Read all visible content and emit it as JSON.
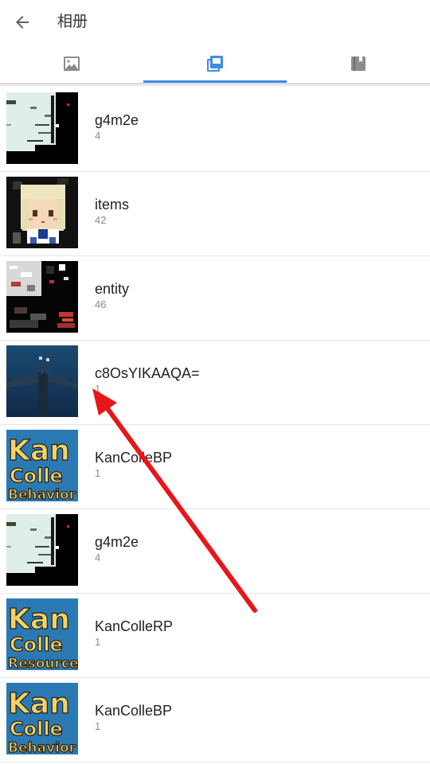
{
  "appbar": {
    "title": "相册",
    "back_icon": "arrow-back-icon"
  },
  "tabs": [
    {
      "icon": "image-icon",
      "selected": false
    },
    {
      "icon": "album-icon",
      "selected": true
    },
    {
      "icon": "collection-icon",
      "selected": false
    }
  ],
  "colors": {
    "accent": "#3f8de8",
    "annotation_arrow": "#e8151b"
  },
  "albums": [
    {
      "name": "g4m2e",
      "count": "4",
      "thumb": "game-screenshot"
    },
    {
      "name": "items",
      "count": "42",
      "thumb": "anime-character"
    },
    {
      "name": "entity",
      "count": "46",
      "thumb": "sprite-sheet"
    },
    {
      "name": "c8OsYIKAAQA=",
      "count": "1",
      "thumb": "dark-blue-image"
    },
    {
      "name": "KanColleBP",
      "count": "1",
      "thumb": "kancolle-behavior-logo",
      "logo_lines": [
        "Kan",
        "Colle",
        "Behavior"
      ]
    },
    {
      "name": "g4m2e",
      "count": "4",
      "thumb": "game-screenshot"
    },
    {
      "name": "KanColleRP",
      "count": "1",
      "thumb": "kancolle-resource-logo",
      "logo_lines": [
        "Kan",
        "Colle",
        "Resource"
      ]
    },
    {
      "name": "KanColleBP",
      "count": "1",
      "thumb": "kancolle-behavior-logo",
      "logo_lines": [
        "Kan",
        "Colle",
        "Behavior"
      ]
    }
  ]
}
